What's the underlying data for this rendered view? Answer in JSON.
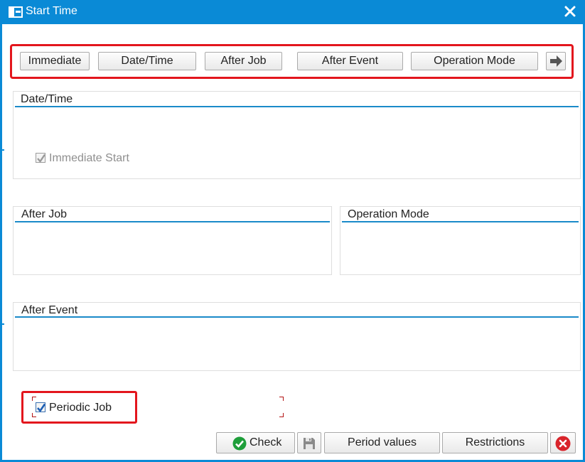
{
  "window": {
    "title": "Start Time",
    "title_icon": "start-time-window-icon",
    "close_icon": "close-x-icon"
  },
  "toolbar": {
    "immediate": "Immediate",
    "date_time": "Date/Time",
    "after_job": "After Job",
    "after_event": "After Event",
    "operation_mode": "Operation Mode",
    "more_icon": "arrow-right-icon"
  },
  "groups": {
    "date_time": {
      "title": "Date/Time",
      "immediate_start_label": "Immediate Start",
      "immediate_start_checked": true,
      "immediate_start_disabled": true
    },
    "after_job": {
      "title": "After Job"
    },
    "operation_mode": {
      "title": "Operation Mode"
    },
    "after_event": {
      "title": "After Event"
    }
  },
  "periodic_job": {
    "label": "Periodic Job",
    "checked": true
  },
  "buttons": {
    "check": "Check",
    "check_icon": "green-checkmark-icon",
    "save_icon": "floppy-disk-icon",
    "period_values": "Period values",
    "restrictions": "Restrictions",
    "cancel_icon": "red-cancel-icon"
  },
  "colors": {
    "title_bar": "#0a8ad6",
    "highlight": "#e3161d",
    "group_line": "#1a8ac9",
    "check_green": "#1e9e3a",
    "cancel_red": "#d9242b"
  }
}
